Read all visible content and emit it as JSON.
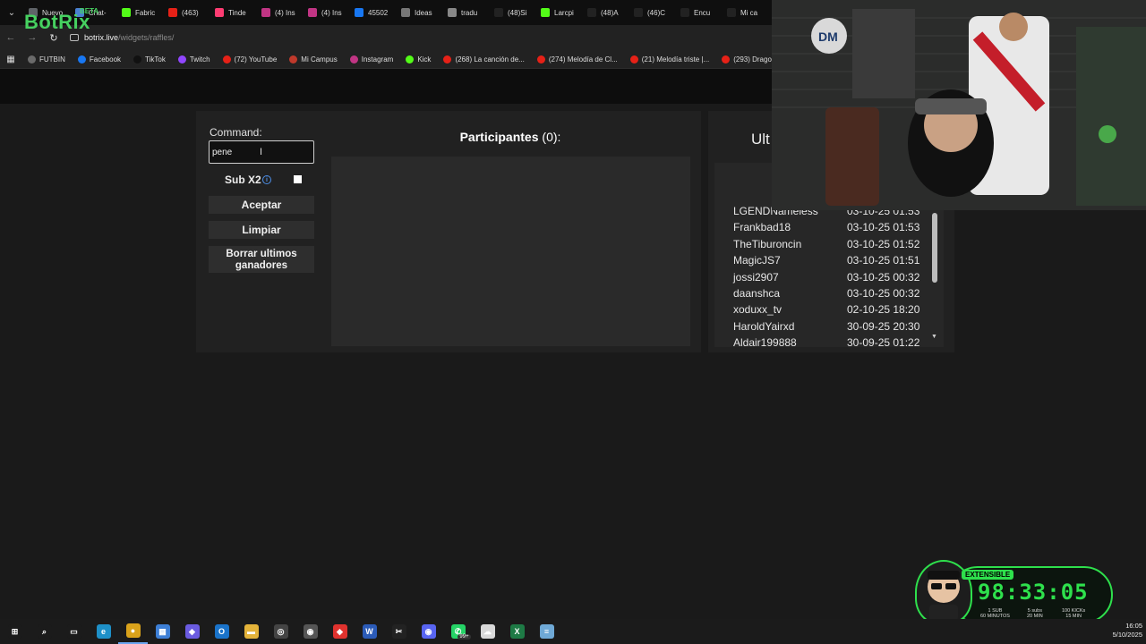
{
  "browser": {
    "tabs": [
      {
        "label": "Nuevo",
        "icon": "chrome-icon",
        "color": "#5f6368"
      },
      {
        "label": "Chat-",
        "icon": "chat-icon",
        "color": "#4a7fd0"
      },
      {
        "label": "Fabric",
        "icon": "kick-icon",
        "color": "#53fc18"
      },
      {
        "label": "(463)",
        "icon": "youtube-icon",
        "color": "#e62117"
      },
      {
        "label": "Tinde",
        "icon": "tinder-icon",
        "color": "#fe3c72"
      },
      {
        "label": "(4) Ins",
        "icon": "instagram-icon",
        "color": "#c13584"
      },
      {
        "label": "(4) Ins",
        "icon": "instagram-icon",
        "color": "#c13584"
      },
      {
        "label": "45502",
        "icon": "facebook-icon",
        "color": "#1877f2"
      },
      {
        "label": "Ideas",
        "icon": "openai-icon",
        "color": "#777777"
      },
      {
        "label": "tradu",
        "icon": "google-icon",
        "color": "#888888"
      },
      {
        "label": "(48)Si",
        "icon": "tiktok-icon",
        "color": "#222222"
      },
      {
        "label": "Larcpi",
        "icon": "kick-icon",
        "color": "#53fc18"
      },
      {
        "label": "(48)A",
        "icon": "tiktok-icon",
        "color": "#222222"
      },
      {
        "label": "(46)C",
        "icon": "tiktok-icon",
        "color": "#222222"
      },
      {
        "label": "Encu",
        "icon": "tiktok-icon",
        "color": "#222222"
      },
      {
        "label": "Mi ca",
        "icon": "tiktok-icon",
        "color": "#222222"
      }
    ],
    "url_host": "botrix.live",
    "url_path": "/widgets/raffles/",
    "bookmarks": [
      {
        "label": "FUTBIN",
        "color": "#6b6b6b"
      },
      {
        "label": "Facebook",
        "color": "#1877f2"
      },
      {
        "label": "TikTok",
        "color": "#111111"
      },
      {
        "label": "Twitch",
        "color": "#9146ff"
      },
      {
        "label": "(72) YouTube",
        "color": "#e62117"
      },
      {
        "label": "Mi Campus",
        "color": "#c0392b"
      },
      {
        "label": "Instagram",
        "color": "#c13584"
      },
      {
        "label": "Kick",
        "color": "#53fc18"
      },
      {
        "label": "(268) La canción de...",
        "color": "#e62117"
      },
      {
        "label": "(274) Melodía de Cl...",
        "color": "#e62117"
      },
      {
        "label": "(21) Melodía triste |...",
        "color": "#e62117"
      },
      {
        "label": "(293) Dragon Ba",
        "color": "#e62117"
      }
    ]
  },
  "app": {
    "logo": "BotRix",
    "beta": "BETA",
    "command_label": "Command:",
    "command_value": "pene",
    "subx2_label": "Sub X2",
    "subx2_checked": false,
    "buttons": {
      "accept": "Aceptar",
      "clear": "Limpiar",
      "clear_winners": "Borrar ultimos ganadores"
    },
    "participants_title": "Participantes",
    "participants_count": "(0):",
    "winners_title": "Ult",
    "winners": [
      {
        "name": "LGENDNameless",
        "date": "03-10-25 01:53"
      },
      {
        "name": "Frankbad18",
        "date": "03-10-25 01:53"
      },
      {
        "name": "TheTiburoncin",
        "date": "03-10-25 01:52"
      },
      {
        "name": "MagicJS7",
        "date": "03-10-25 01:51"
      },
      {
        "name": "jossi2907",
        "date": "03-10-25 00:32"
      },
      {
        "name": "daanshca",
        "date": "03-10-25 00:32"
      },
      {
        "name": "xoduxx_tv",
        "date": "02-10-25 18:20"
      },
      {
        "name": "HaroldYairxd",
        "date": "30-09-25 20:30"
      },
      {
        "name": "Aldair199888",
        "date": "30-09-25 01:22"
      }
    ],
    "accent_color": "#46d160"
  },
  "timer": {
    "badge": "EXTENSIBLE",
    "value": "98:33:05",
    "tiers": [
      {
        "top": "1 SUB",
        "bottom": "60 MINUTOS"
      },
      {
        "top": "5 subs",
        "bottom": "20 MIN"
      },
      {
        "top": "100 KICKs",
        "bottom": "15 MIN"
      }
    ]
  },
  "taskbar": {
    "time": "16:05",
    "date": "5/10/2025",
    "whatsapp_badge": "99+"
  }
}
